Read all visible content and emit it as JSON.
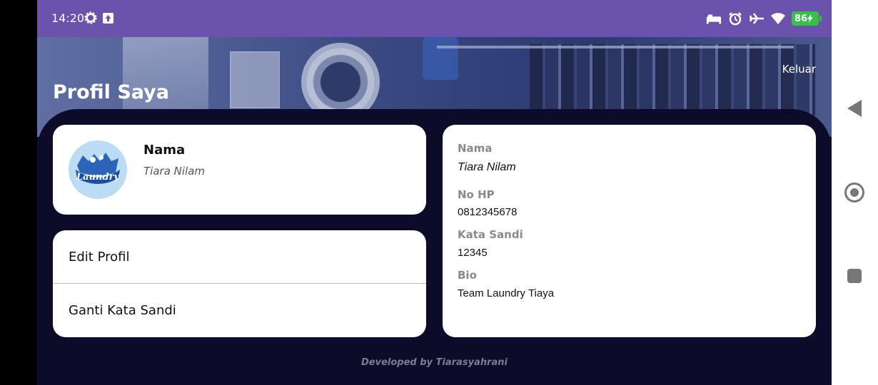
{
  "status_bar": {
    "time": "14:20",
    "battery": "86",
    "icons": [
      "settings-icon",
      "upload-icon",
      "bed-icon",
      "alarm-icon",
      "airplane-icon",
      "wifi-icon",
      "battery-charging-icon"
    ],
    "background": "#6b52ad",
    "battery_color": "#36c04a"
  },
  "header": {
    "title": "Profil Saya",
    "logout_label": "Keluar"
  },
  "profile_card": {
    "name_label": "Nama",
    "name_value": "Tiara Nilam",
    "avatar_logo": "Laundry",
    "avatar_color": "#bcdcf6"
  },
  "menu": {
    "items": [
      {
        "label": "Edit Profil"
      },
      {
        "label": "Ganti Kata Sandi"
      }
    ]
  },
  "info_card": {
    "fields": [
      {
        "label": "Nama",
        "value": "Tiara Nilam"
      },
      {
        "label": "No HP",
        "value": "0812345678"
      },
      {
        "label": "Kata Sandi",
        "value": "12345"
      },
      {
        "label": "Bio",
        "value": "Team Laundry Tiaya"
      }
    ]
  },
  "footer": {
    "credit": "Developed by Tiarasyahrani"
  },
  "theme": {
    "content_background": "#0c0c2a",
    "card_background": "#ffffff"
  },
  "nav_bar": {
    "icons": [
      "back-icon",
      "home-icon",
      "recent-apps-icon"
    ]
  }
}
